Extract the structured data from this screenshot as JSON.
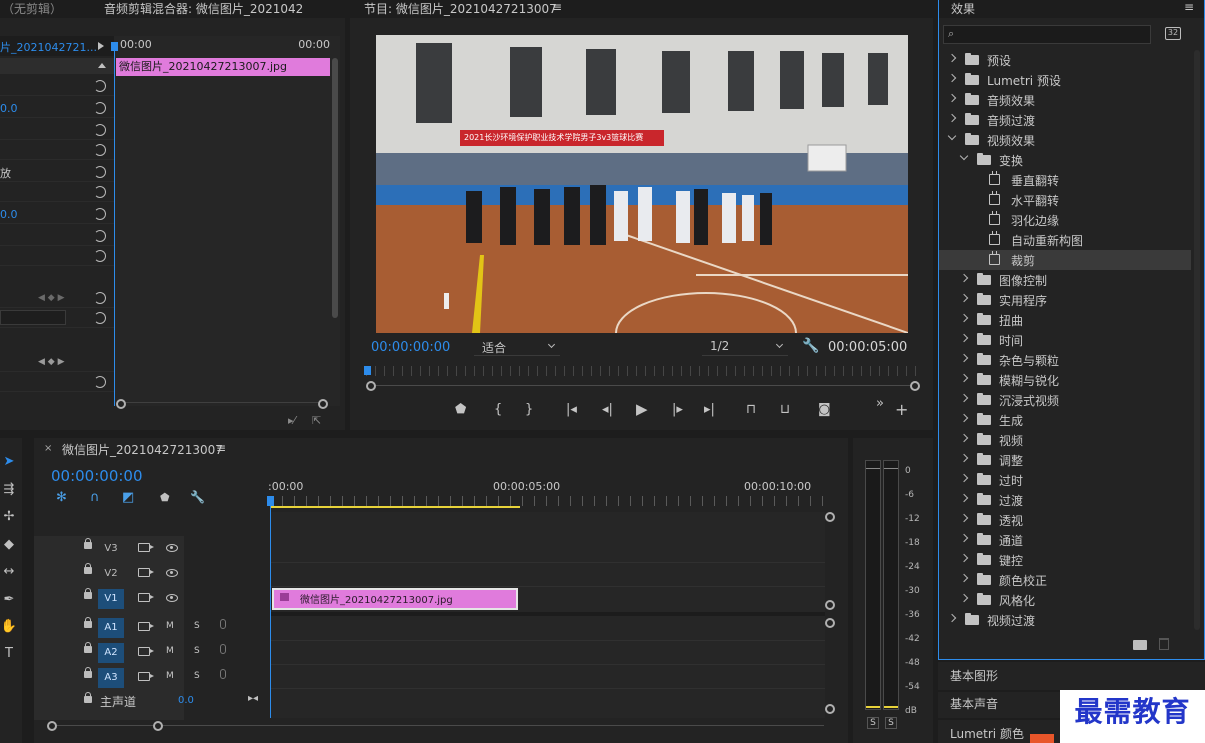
{
  "source_panel": {
    "no_clip": "（无剪辑）",
    "mixer_title": "音频剪辑混合器: 微信图片_2021042",
    "clip_tab": "片_2021042721...",
    "time_start": "00:00",
    "time_end": "00:00",
    "clip_name": "微信图片_20210427213007.jpg",
    "left_vals": [
      "0.0",
      "0.0"
    ],
    "left_label": "放"
  },
  "program": {
    "title": "节目: 微信图片_20210427213007",
    "timecode": "00:00:00:00",
    "fit": "适合",
    "quality": "1/2",
    "duration": "00:00:05:00",
    "banner": "2021长沙环境保护职业技术学院男子3v3篮球比赛"
  },
  "effects": {
    "title": "效果",
    "search_placeholder": "",
    "items": [
      {
        "label": "预设",
        "type": "preset",
        "level": 0,
        "state": "closed"
      },
      {
        "label": "Lumetri 预设",
        "type": "preset",
        "level": 0,
        "state": "closed"
      },
      {
        "label": "音频效果",
        "type": "folder",
        "level": 0,
        "state": "closed"
      },
      {
        "label": "音频过渡",
        "type": "folder",
        "level": 0,
        "state": "closed"
      },
      {
        "label": "视频效果",
        "type": "folder",
        "level": 0,
        "state": "open"
      },
      {
        "label": "变换",
        "type": "folder",
        "level": 1,
        "state": "open"
      },
      {
        "label": "垂直翻转",
        "type": "fx",
        "level": 2
      },
      {
        "label": "水平翻转",
        "type": "fx",
        "level": 2
      },
      {
        "label": "羽化边缘",
        "type": "fx",
        "level": 2
      },
      {
        "label": "自动重新构图",
        "type": "fx",
        "level": 2
      },
      {
        "label": "裁剪",
        "type": "fx",
        "level": 2,
        "selected": true
      },
      {
        "label": "图像控制",
        "type": "folder",
        "level": 1,
        "state": "closed"
      },
      {
        "label": "实用程序",
        "type": "folder",
        "level": 1,
        "state": "closed"
      },
      {
        "label": "扭曲",
        "type": "folder",
        "level": 1,
        "state": "closed"
      },
      {
        "label": "时间",
        "type": "folder",
        "level": 1,
        "state": "closed"
      },
      {
        "label": "杂色与颗粒",
        "type": "folder",
        "level": 1,
        "state": "closed"
      },
      {
        "label": "模糊与锐化",
        "type": "folder",
        "level": 1,
        "state": "closed"
      },
      {
        "label": "沉浸式视频",
        "type": "folder",
        "level": 1,
        "state": "closed"
      },
      {
        "label": "生成",
        "type": "folder",
        "level": 1,
        "state": "closed"
      },
      {
        "label": "视频",
        "type": "folder",
        "level": 1,
        "state": "closed"
      },
      {
        "label": "调整",
        "type": "folder",
        "level": 1,
        "state": "closed"
      },
      {
        "label": "过时",
        "type": "folder",
        "level": 1,
        "state": "closed"
      },
      {
        "label": "过渡",
        "type": "folder",
        "level": 1,
        "state": "closed"
      },
      {
        "label": "透视",
        "type": "folder",
        "level": 1,
        "state": "closed"
      },
      {
        "label": "通道",
        "type": "folder",
        "level": 1,
        "state": "closed"
      },
      {
        "label": "键控",
        "type": "folder",
        "level": 1,
        "state": "closed"
      },
      {
        "label": "颜色校正",
        "type": "folder",
        "level": 1,
        "state": "closed"
      },
      {
        "label": "风格化",
        "type": "folder",
        "level": 1,
        "state": "closed"
      },
      {
        "label": "视频过渡",
        "type": "folder",
        "level": 0,
        "state": "closed"
      }
    ]
  },
  "sub_panels": [
    "基本图形",
    "基本声音",
    "Lumetri 颜色"
  ],
  "watermark": "最需教育",
  "timeline": {
    "title": "微信图片_20210427213007",
    "timecode": "00:00:00:00",
    "ruler": [
      ":00:00",
      "00:00:05:00",
      "00:00:10:00"
    ],
    "clip": "微信图片_20210427213007.jpg",
    "video_tracks": [
      "V3",
      "V2",
      "V1"
    ],
    "audio_tracks": [
      "A1",
      "A2",
      "A3"
    ],
    "master": "主声道",
    "master_val": "0.0",
    "mute": "M",
    "solo": "S"
  },
  "meter": {
    "labels": [
      "0",
      "-6",
      "-12",
      "-18",
      "-24",
      "-30",
      "-36",
      "-42",
      "-48",
      "-54",
      "dB"
    ],
    "solo": [
      "S",
      "S"
    ]
  }
}
